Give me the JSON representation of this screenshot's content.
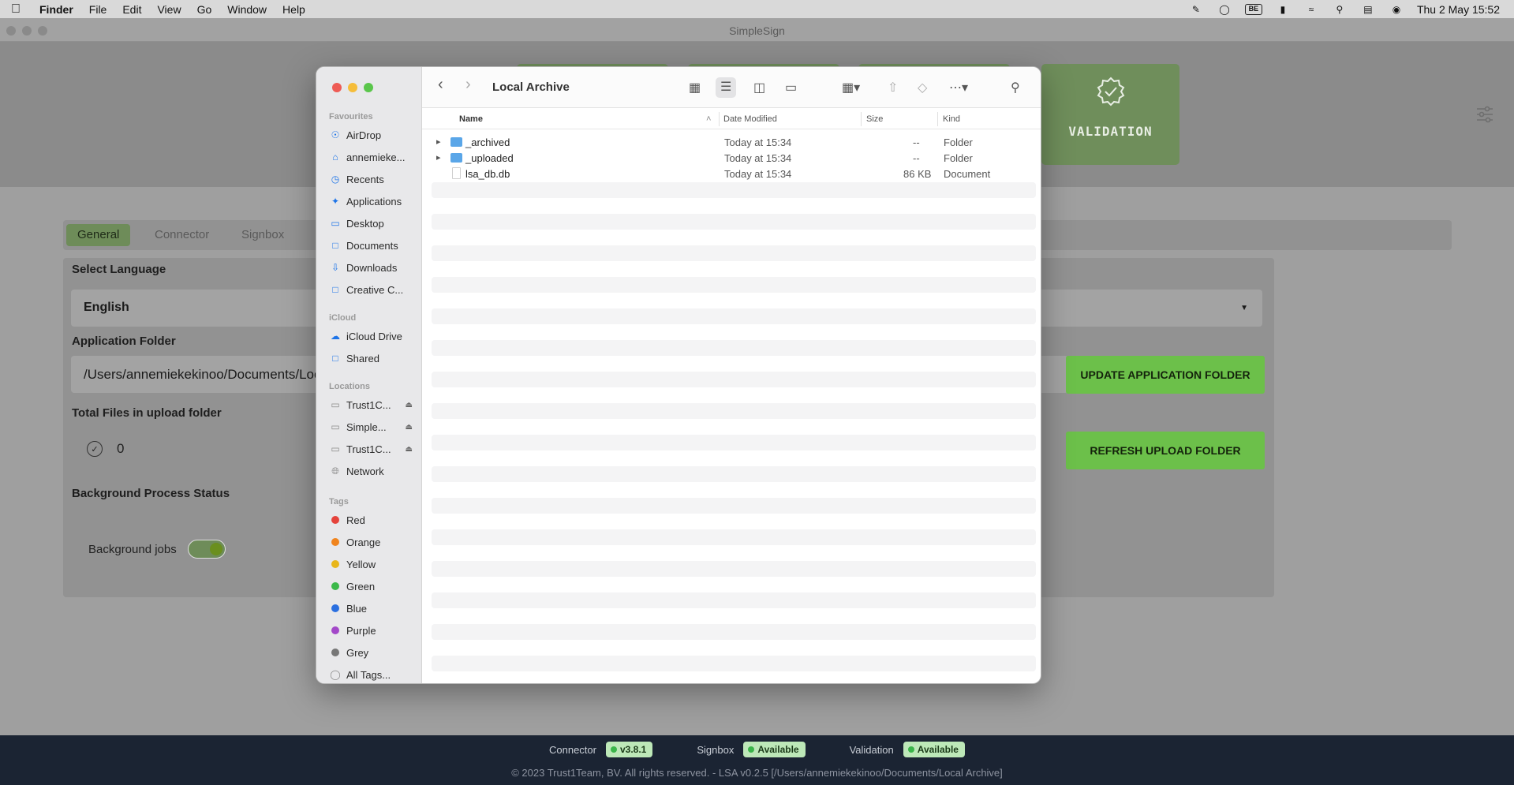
{
  "menubar": {
    "app": "Finder",
    "items": [
      "File",
      "Edit",
      "View",
      "Go",
      "Window",
      "Help"
    ],
    "keyboard_badge": "BE",
    "clock": "Thu 2 May  15:52"
  },
  "app": {
    "window_title": "SimpleSign",
    "validation_label": "VALIDATION",
    "tabs": [
      "General",
      "Connector",
      "Signbox"
    ],
    "select_language_label": "Select Language",
    "language_value": "English",
    "application_folder_label": "Application Folder",
    "application_folder_value": "/Users/annemiekekinoo/Documents/Local Archive",
    "update_button": "UPDATE APPLICATION FOLDER",
    "total_files_label": "Total Files in upload folder",
    "total_files_value": "0",
    "refresh_button": "REFRESH UPLOAD FOLDER",
    "bg_status_label": "Background Process Status",
    "bg_jobs_label": "Background jobs"
  },
  "footer": {
    "connector_label": "Connector",
    "connector_version": "v3.8.1",
    "signbox_label": "Signbox",
    "signbox_status": "Available",
    "validation_label": "Validation",
    "validation_status": "Available",
    "copyright": "© 2023 Trust1Team, BV. All rights reserved. - LSA v0.2.5 [/Users/annemiekekinoo/Documents/Local Archive]"
  },
  "finder": {
    "title": "Local Archive",
    "sidebar": {
      "favourites_heading": "Favourites",
      "favourites": [
        "AirDrop",
        "annemieke...",
        "Recents",
        "Applications",
        "Desktop",
        "Documents",
        "Downloads",
        "Creative C..."
      ],
      "icloud_heading": "iCloud",
      "icloud": [
        "iCloud Drive",
        "Shared"
      ],
      "locations_heading": "Locations",
      "locations": [
        "Trust1C...",
        "Simple...",
        "Trust1C...",
        "Network"
      ],
      "tags_heading": "Tags",
      "tags": [
        {
          "label": "Red",
          "color": "#e5433c"
        },
        {
          "label": "Orange",
          "color": "#f0841e"
        },
        {
          "label": "Yellow",
          "color": "#e8b61a"
        },
        {
          "label": "Green",
          "color": "#3cb94a"
        },
        {
          "label": "Blue",
          "color": "#2a6fe0"
        },
        {
          "label": "Purple",
          "color": "#a348c9"
        },
        {
          "label": "Grey",
          "color": "#777777"
        }
      ],
      "all_tags": "All Tags..."
    },
    "columns": {
      "name": "Name",
      "date": "Date Modified",
      "size": "Size",
      "kind": "Kind"
    },
    "files": [
      {
        "name": "_archived",
        "date": "Today at 15:34",
        "size": "--",
        "kind": "Folder",
        "type": "folder"
      },
      {
        "name": "_uploaded",
        "date": "Today at 15:34",
        "size": "--",
        "kind": "Folder",
        "type": "folder"
      },
      {
        "name": "lsa_db.db",
        "date": "Today at 15:34",
        "size": "86 KB",
        "kind": "Document",
        "type": "document"
      }
    ]
  },
  "colors": {
    "accent": "#6cc04a",
    "footer_bg": "#1b2433",
    "folder": "#5aa6e8"
  }
}
